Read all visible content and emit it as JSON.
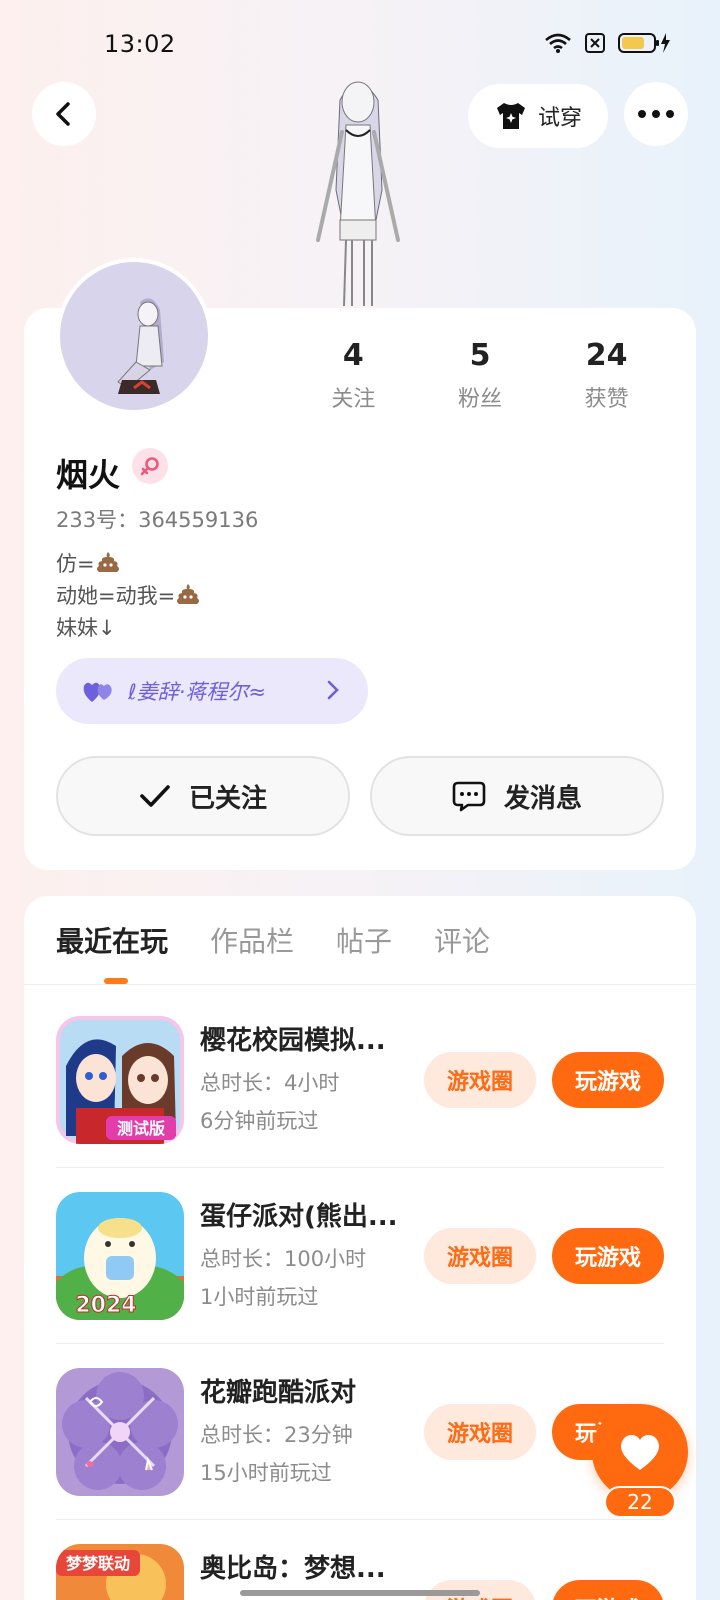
{
  "status_bar": {
    "time": "13:02"
  },
  "header": {
    "tryon_label": "试穿"
  },
  "profile": {
    "name": "烟火",
    "uid": "233号：364559136",
    "bio_lines": [
      "仿=",
      "动她=动我=",
      "妹妹↓"
    ],
    "friend_tag": "ℓ姜辞·蒋程尔≈",
    "stats": [
      {
        "value": "4",
        "label": "关注"
      },
      {
        "value": "5",
        "label": "粉丝"
      },
      {
        "value": "24",
        "label": "获赞"
      }
    ],
    "follow_label": "已关注",
    "message_label": "发消息"
  },
  "tabs": [
    "最近在玩",
    "作品栏",
    "帖子",
    "评论"
  ],
  "game_button_circle": "游戏圈",
  "game_button_play": "玩游戏",
  "games": [
    {
      "title": "樱花校园模拟...",
      "duration": "总时长：4小时",
      "last_played": "6分钟前玩过",
      "badge": "测试版"
    },
    {
      "title": "蛋仔派对(熊出...",
      "duration": "总时长：100小时",
      "last_played": "1小时前玩过",
      "badge": "2024"
    },
    {
      "title": "花瓣跑酷派对",
      "duration": "总时长：23分钟",
      "last_played": "15小时前玩过",
      "badge": ""
    },
    {
      "title": "奥比岛：梦想...",
      "duration": "",
      "last_played": "",
      "badge": "梦梦联动"
    }
  ],
  "like_count": "22",
  "colors": {
    "accent": "#ff6a10",
    "accent_light": "#ffe8dc",
    "tag_bg": "#ebe8fb",
    "tag_text": "#6e5fdc"
  }
}
